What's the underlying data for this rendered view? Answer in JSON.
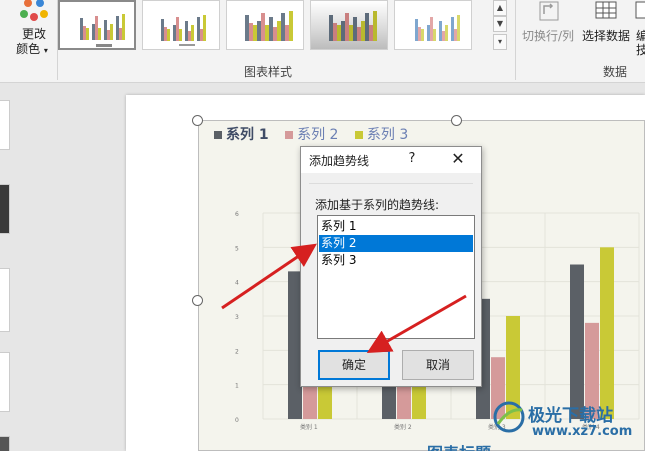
{
  "ribbon": {
    "change_colors_line1": "更改",
    "change_colors_line2": "颜色",
    "chart_styles_group": "图表样式",
    "switch_row_col": "切换行/列",
    "select_data": "选择数据",
    "edit_data_line1": "编",
    "edit_data_line2": "技",
    "data_group": "数据"
  },
  "chart": {
    "legend": [
      {
        "label": "系列 1",
        "color": "#5b6066"
      },
      {
        "label": "系列 2",
        "color": "#d59a9a"
      },
      {
        "label": "系列 3",
        "color": "#c9c936"
      }
    ],
    "title_partial": "图表标题"
  },
  "chart_data": {
    "type": "bar",
    "categories": [
      "类别 1",
      "类别 2",
      "类别 3",
      "类别 4"
    ],
    "series": [
      {
        "name": "系列 1",
        "values": [
          4.3,
          2.5,
          3.5,
          4.5
        ]
      },
      {
        "name": "系列 2",
        "values": [
          2.4,
          4.4,
          1.8,
          2.8
        ]
      },
      {
        "name": "系列 3",
        "values": [
          2,
          2,
          3,
          5
        ]
      }
    ],
    "ylim": [
      0,
      6
    ],
    "yticks": [
      "0",
      "1",
      "2",
      "3",
      "4",
      "5",
      "6"
    ],
    "grid": true,
    "legend_position": "top-left"
  },
  "dialog": {
    "title": "添加趋势线",
    "help": "?",
    "close": "✕",
    "prompt": "添加基于系列的趋势线:",
    "items": [
      {
        "label": "系列 1",
        "selected": false
      },
      {
        "label": "系列 2",
        "selected": true
      },
      {
        "label": "系列 3",
        "selected": false
      }
    ],
    "ok": "确定",
    "cancel": "取消"
  },
  "watermark": {
    "name": "极光下载站",
    "url": "www.xz7.com"
  },
  "colors": {
    "accent": "#0078d7",
    "arrow": "#d62020"
  }
}
